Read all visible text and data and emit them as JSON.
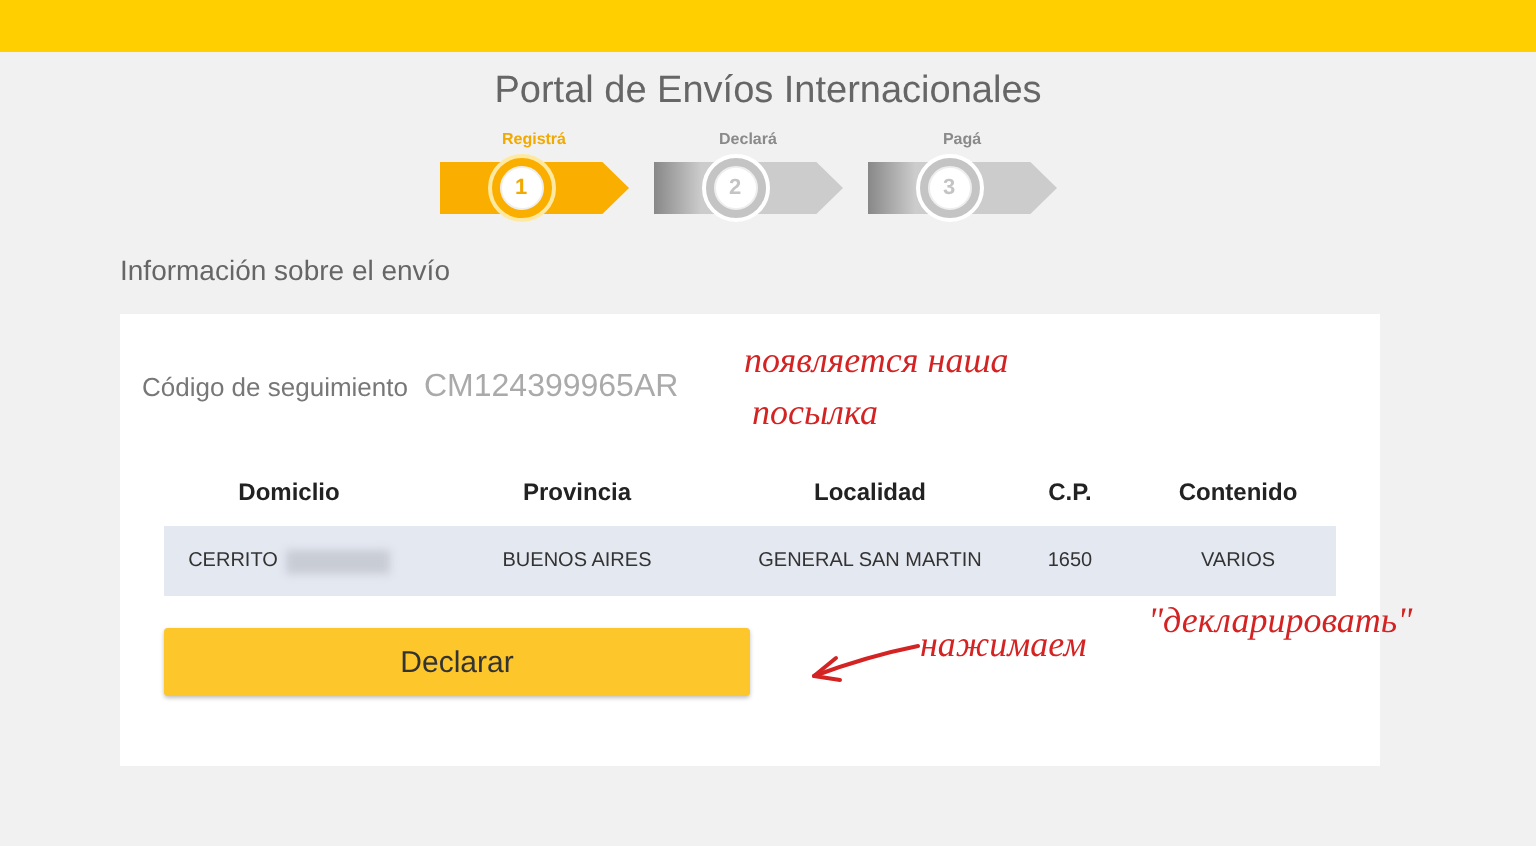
{
  "header": {
    "title": "Portal de Envíos Internacionales"
  },
  "steps": [
    {
      "label": "Registrá",
      "number": "1",
      "selected": true
    },
    {
      "label": "Declará",
      "number": "2",
      "selected": false
    },
    {
      "label": "Pagá",
      "number": "3",
      "selected": false
    }
  ],
  "section_title": "Información sobre el envío",
  "tracking": {
    "label": "Código de seguimiento",
    "value": "CM124399965AR"
  },
  "table": {
    "columns": [
      "Domiclio",
      "Provincia",
      "Localidad",
      "C.P.",
      "Contenido"
    ],
    "rows": [
      {
        "cells": [
          {
            "text": "CERRITO",
            "redacted": true
          },
          {
            "text": "BUENOS AIRES"
          },
          {
            "text": "GENERAL SAN MARTIN"
          },
          {
            "text": "1650"
          },
          {
            "text": "VARIOS"
          }
        ]
      }
    ]
  },
  "button": "Declarar",
  "annotations": [
    {
      "kind": "text",
      "text": "появляется наша"
    },
    {
      "kind": "text",
      "text": "посылка"
    },
    {
      "kind": "arrow"
    },
    {
      "kind": "text",
      "text": "нажимаем"
    },
    {
      "kind": "text",
      "text": "\"декларировать\""
    }
  ]
}
